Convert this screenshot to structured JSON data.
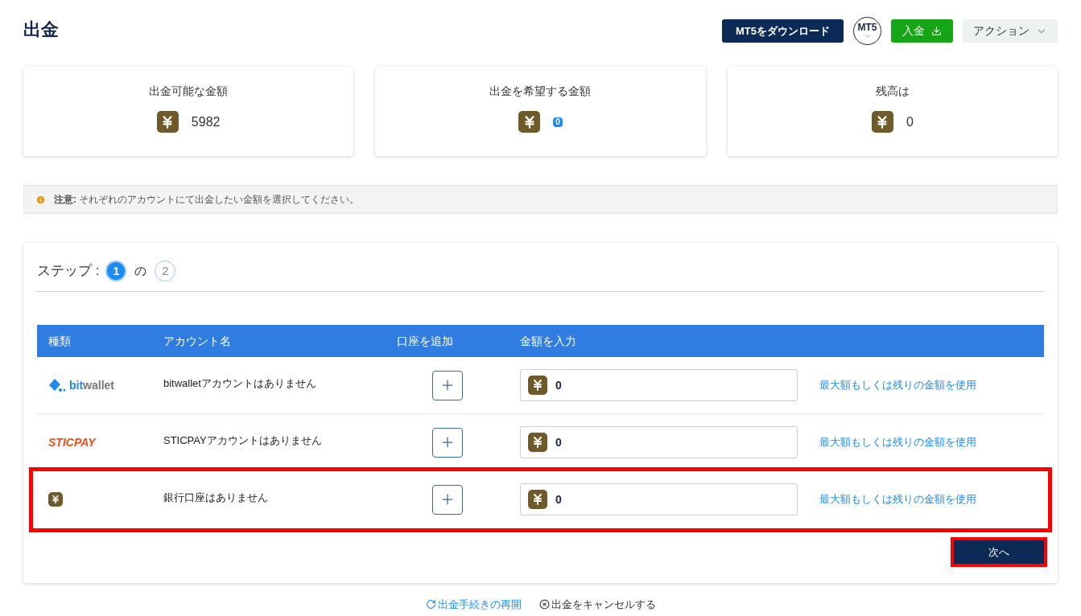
{
  "title": "出金",
  "header_actions": {
    "download": "MT5をダウンロード",
    "platform": "MT5",
    "deposit": "入金",
    "actions": "アクション"
  },
  "summary": [
    {
      "label": "出金可能な金額",
      "value": "5982",
      "kind": "plain"
    },
    {
      "label": "出金を希望する金額",
      "value": "0",
      "kind": "badge"
    },
    {
      "label": "残高は",
      "value": "0",
      "kind": "plain"
    }
  ],
  "notice": {
    "label": "注意:",
    "text": "それぞれのアカウントにて出金したい金額を選択してください。"
  },
  "steps": {
    "label": "ステップ :",
    "separator": "の",
    "items": [
      {
        "number": "1",
        "selected": true
      },
      {
        "number": "2",
        "selected": false
      }
    ]
  },
  "table": {
    "columns": [
      "種類",
      "アカウント名",
      "口座を追加",
      "金額を入力"
    ],
    "rows": [
      {
        "kind": "bitwallet",
        "logo": [
          "bit",
          "wallet"
        ],
        "account": "bitwalletアカウントはありません",
        "amount": "0",
        "link": "最大額もしくは残りの金額を使用",
        "highlighted": false
      },
      {
        "kind": "sticpay",
        "logo": [
          "STICPAY"
        ],
        "account": "STICPAYアカウントはありません",
        "amount": "0",
        "link": "最大額もしくは残りの金額を使用",
        "highlighted": false
      },
      {
        "kind": "bank",
        "account": "銀行口座はありません",
        "amount": "0",
        "link": "最大額もしくは残りの金額を使用",
        "highlighted": true
      }
    ]
  },
  "next": {
    "label": "次へ",
    "highlighted": true
  },
  "footer_links": [
    {
      "kind": "restart",
      "label": "出金手続きの再開"
    },
    {
      "kind": "cancel",
      "label": "出金をキャンセルする"
    }
  ]
}
